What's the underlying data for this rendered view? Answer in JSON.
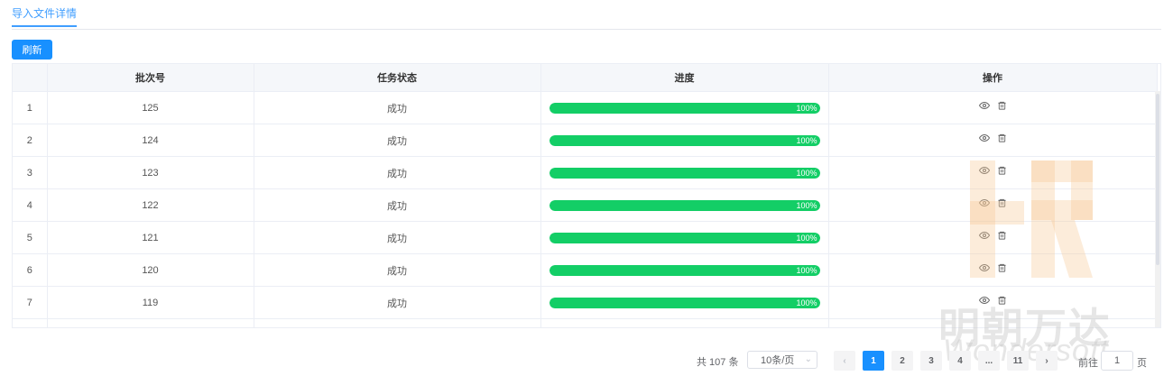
{
  "tabs": [
    {
      "label": "导入文件详情"
    }
  ],
  "toolbar": {
    "refresh_label": "刷新"
  },
  "table": {
    "columns": [
      "",
      "批次号",
      "任务状态",
      "进度",
      "操作"
    ],
    "rows": [
      {
        "index": "1",
        "batch": "125",
        "status": "成功",
        "progress": 100,
        "progress_label": "100%"
      },
      {
        "index": "2",
        "batch": "124",
        "status": "成功",
        "progress": 100,
        "progress_label": "100%"
      },
      {
        "index": "3",
        "batch": "123",
        "status": "成功",
        "progress": 100,
        "progress_label": "100%"
      },
      {
        "index": "4",
        "batch": "122",
        "status": "成功",
        "progress": 100,
        "progress_label": "100%"
      },
      {
        "index": "5",
        "batch": "121",
        "status": "成功",
        "progress": 100,
        "progress_label": "100%"
      },
      {
        "index": "6",
        "batch": "120",
        "status": "成功",
        "progress": 100,
        "progress_label": "100%"
      },
      {
        "index": "7",
        "batch": "119",
        "status": "成功",
        "progress": 100,
        "progress_label": "100%"
      }
    ],
    "actions": [
      "view-icon",
      "delete-icon"
    ]
  },
  "pagination": {
    "total_label": "共 107 条",
    "page_size_label": "10条/页",
    "pages": [
      "1",
      "2",
      "3",
      "4",
      "...",
      "11"
    ],
    "current_page": "1",
    "goto_label": "前往",
    "goto_value": "1",
    "goto_unit": "页"
  },
  "watermark": {
    "text": "明朝万达",
    "sub": "Wondersoft"
  },
  "colors": {
    "accent": "#1890ff",
    "success": "#13ce66",
    "tab_active": "#409eff"
  }
}
